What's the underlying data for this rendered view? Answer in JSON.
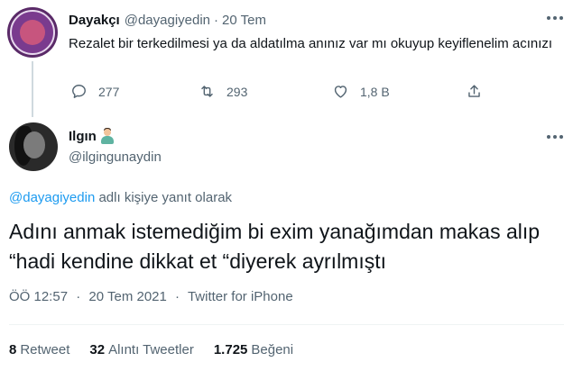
{
  "parent_tweet": {
    "author_name": "Dayakçı",
    "author_handle": "@dayagiyedin",
    "separator": "·",
    "time": "20 Tem",
    "text": "Rezalet bir terkedilmesi ya da aldatılma anınız var mı okuyup keyiflenelim acınızı",
    "actions": {
      "replies": "277",
      "retweets": "293",
      "likes": "1,8 B"
    }
  },
  "main_tweet": {
    "author_name": "Ilgın",
    "author_handle": "@ilgingunaydin",
    "reply_context": {
      "handle": "@dayagiyedin",
      "suffix": "adlı kişiye yanıt olarak"
    },
    "text": "Adını anmak istemediğim bi exim yanağımdan makas alıp “hadi kendine dikkat et “diyerek ayrılmıştı",
    "meta": {
      "time": "ÖÖ 12:57",
      "date": "20 Tem 2021",
      "source": "Twitter for iPhone",
      "separator": "·"
    },
    "stats": {
      "retweets_count": "8",
      "retweets_label": "Retweet",
      "quotes_count": "32",
      "quotes_label": "Alıntı Tweetler",
      "likes_count": "1.725",
      "likes_label": "Beğeni"
    }
  },
  "colors": {
    "text_primary": "#0f1419",
    "text_secondary": "#536471",
    "link": "#1d9bf0",
    "divider": "#eff3f4"
  },
  "icons": {
    "reply": "reply-icon",
    "retweet": "retweet-icon",
    "like": "heart-icon",
    "share": "share-icon",
    "more": "more-icon"
  }
}
